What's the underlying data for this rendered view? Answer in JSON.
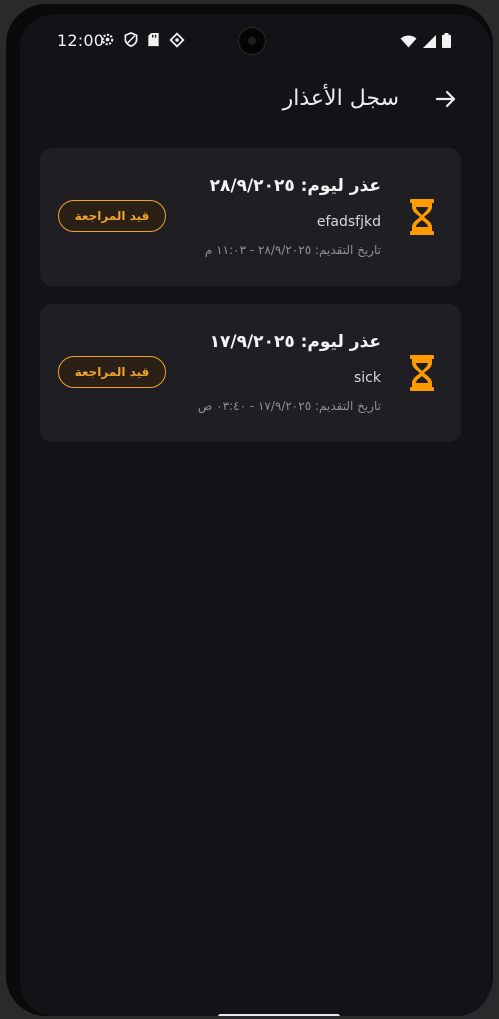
{
  "status_bar": {
    "time": "12:00",
    "icons": [
      "gear-icon",
      "shield-icon",
      "sd-card-icon",
      "diamond-icon"
    ],
    "right_icons": [
      "wifi-icon",
      "signal-icon",
      "battery-icon"
    ]
  },
  "header": {
    "title": "سجل الأعذار",
    "back_icon": "arrow-right-icon"
  },
  "excuses": [
    {
      "title": "عذر ليوم: ٢٨/٩/٢٠٢٥",
      "reason": "efadsfjkd",
      "submitted": "تاريخ التقديم: ٢٨/٩/٢٠٢٥ - ١١:٠٣ م",
      "status": "قيد المراجعة",
      "icon": "hourglass-icon"
    },
    {
      "title": "عذر ليوم: ١٧/٩/٢٠٢٥",
      "reason": "sick",
      "submitted": "تاريخ التقديم: ١٧/٩/٢٠٢٥ - ٠٣:٤٠ ص",
      "status": "قيد المراجعة",
      "icon": "hourglass-icon"
    }
  ],
  "colors": {
    "background": "#131216",
    "card": "#1f1e23",
    "accent": "#f0a22a",
    "hourglass": "#ff9a00"
  }
}
